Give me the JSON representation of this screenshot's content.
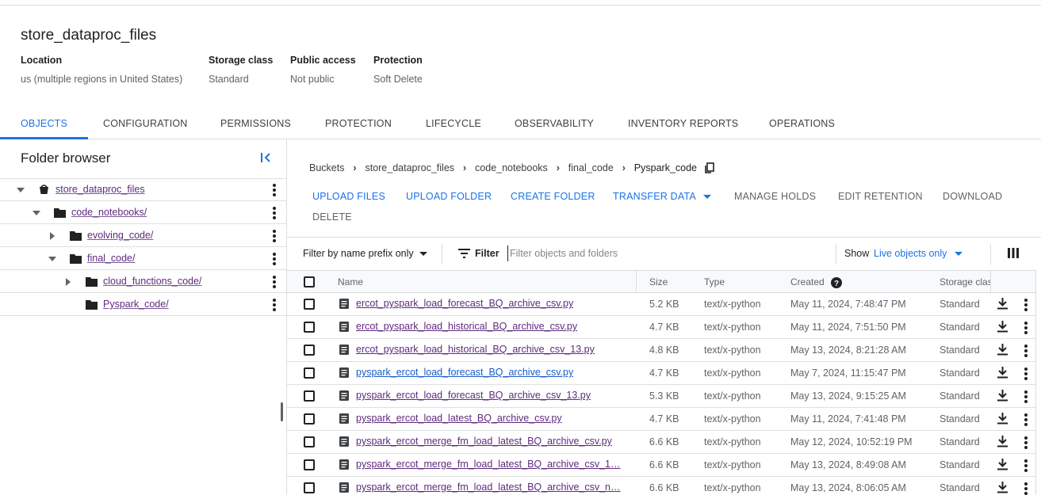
{
  "bucket": {
    "name": "store_dataproc_files",
    "meta": [
      {
        "label": "Location",
        "value": "us (multiple regions in United States)"
      },
      {
        "label": "Storage class",
        "value": "Standard"
      },
      {
        "label": "Public access",
        "value": "Not public"
      },
      {
        "label": "Protection",
        "value": "Soft Delete"
      }
    ]
  },
  "tabs": [
    "OBJECTS",
    "CONFIGURATION",
    "PERMISSIONS",
    "PROTECTION",
    "LIFECYCLE",
    "OBSERVABILITY",
    "INVENTORY REPORTS",
    "OPERATIONS"
  ],
  "folder_browser": {
    "title": "Folder browser",
    "items": [
      {
        "label": "store_dataproc_files",
        "icon": "bucket-icon",
        "expanded": true
      },
      {
        "label": "code_notebooks/",
        "icon": "folder-icon",
        "expanded": true
      },
      {
        "label": "evolving_code/",
        "icon": "folder-icon",
        "expanded": false
      },
      {
        "label": "final_code/",
        "icon": "folder-icon",
        "expanded": true
      },
      {
        "label": "cloud_functions_code/",
        "icon": "folder-icon",
        "expanded": false
      },
      {
        "label": "Pyspark_code/",
        "icon": "folder-icon",
        "expanded": null
      }
    ]
  },
  "breadcrumb": [
    "Buckets",
    "store_dataproc_files",
    "code_notebooks",
    "final_code",
    "Pyspark_code"
  ],
  "actions": {
    "upload_files": "UPLOAD FILES",
    "upload_folder": "UPLOAD FOLDER",
    "create_folder": "CREATE FOLDER",
    "transfer_data": "TRANSFER DATA",
    "manage_holds": "MANAGE HOLDS",
    "edit_retention": "EDIT RETENTION",
    "download": "DOWNLOAD",
    "delete": "DELETE"
  },
  "filter": {
    "mode": "Filter by name prefix only",
    "label": "Filter",
    "placeholder": "Filter objects and folders",
    "show_label": "Show",
    "show_value": "Live objects only"
  },
  "table": {
    "headers": {
      "name": "Name",
      "size": "Size",
      "type": "Type",
      "created": "Created",
      "storage": "Storage clas"
    },
    "rows": [
      {
        "name": "ercot_pyspark_load_forecast_BQ_archive_csv.py",
        "size": "5.2 KB",
        "type": "text/x-python",
        "created": "May 11, 2024, 7:48:47 PM",
        "storage": "Standard",
        "visited": true
      },
      {
        "name": "ercot_pyspark_load_historical_BQ_archive_csv.py",
        "size": "4.7 KB",
        "type": "text/x-python",
        "created": "May 11, 2024, 7:51:50 PM",
        "storage": "Standard",
        "visited": true
      },
      {
        "name": "ercot_pyspark_load_historical_BQ_archive_csv_13.py",
        "size": "4.8 KB",
        "type": "text/x-python",
        "created": "May 13, 2024, 8:21:28 AM",
        "storage": "Standard",
        "visited": true
      },
      {
        "name": "pyspark_ercot_load_forecast_BQ_archive_csv.py",
        "size": "4.7 KB",
        "type": "text/x-python",
        "created": "May 7, 2024, 11:15:47 PM",
        "storage": "Standard",
        "visited": false
      },
      {
        "name": "pyspark_ercot_load_forecast_BQ_archive_csv_13.py",
        "size": "5.3 KB",
        "type": "text/x-python",
        "created": "May 13, 2024, 9:15:25 AM",
        "storage": "Standard",
        "visited": true
      },
      {
        "name": "pyspark_ercot_load_latest_BQ_archive_csv.py",
        "size": "4.7 KB",
        "type": "text/x-python",
        "created": "May 11, 2024, 7:41:48 PM",
        "storage": "Standard",
        "visited": true
      },
      {
        "name": "pyspark_ercot_merge_fm_load_latest_BQ_archive_csv.py",
        "size": "6.6 KB",
        "type": "text/x-python",
        "created": "May 12, 2024, 10:52:19 PM",
        "storage": "Standard",
        "visited": true
      },
      {
        "name": "pyspark_ercot_merge_fm_load_latest_BQ_archive_csv_1…",
        "size": "6.6 KB",
        "type": "text/x-python",
        "created": "May 13, 2024, 8:49:08 AM",
        "storage": "Standard",
        "visited": true
      },
      {
        "name": "pyspark_ercot_merge_fm_load_latest_BQ_archive_csv_n…",
        "size": "6.6 KB",
        "type": "text/x-python",
        "created": "May 13, 2024, 8:06:05 AM",
        "storage": "Standard",
        "visited": true
      }
    ]
  },
  "colors": {
    "accent": "#1a73e8",
    "visited_link": "#5f2a7e",
    "border": "#dadce0"
  }
}
